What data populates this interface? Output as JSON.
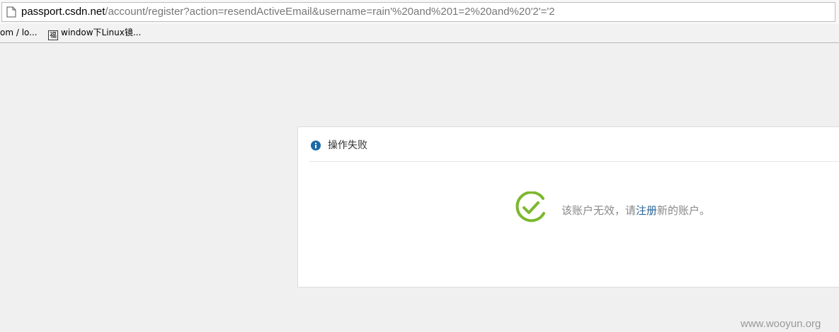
{
  "browser": {
    "url_host": "passport.csdn.net",
    "url_path": "/account/register?action=resendActiveEmail&username=rain'%20and%201=2%20and%20'2'='2",
    "bookmarks": [
      {
        "label": "om / lo..."
      },
      {
        "label": "window下Linux镜...",
        "favicon": "福"
      }
    ]
  },
  "dialog": {
    "title": "操作失败",
    "message_before": "该账户无效，请",
    "message_link": "注册",
    "message_after": "新的账户。"
  },
  "watermark": "www.wooyun.org",
  "colors": {
    "info_icon": "#1a6aa6",
    "success_icon": "#7cb82f",
    "link": "#2a6496"
  }
}
